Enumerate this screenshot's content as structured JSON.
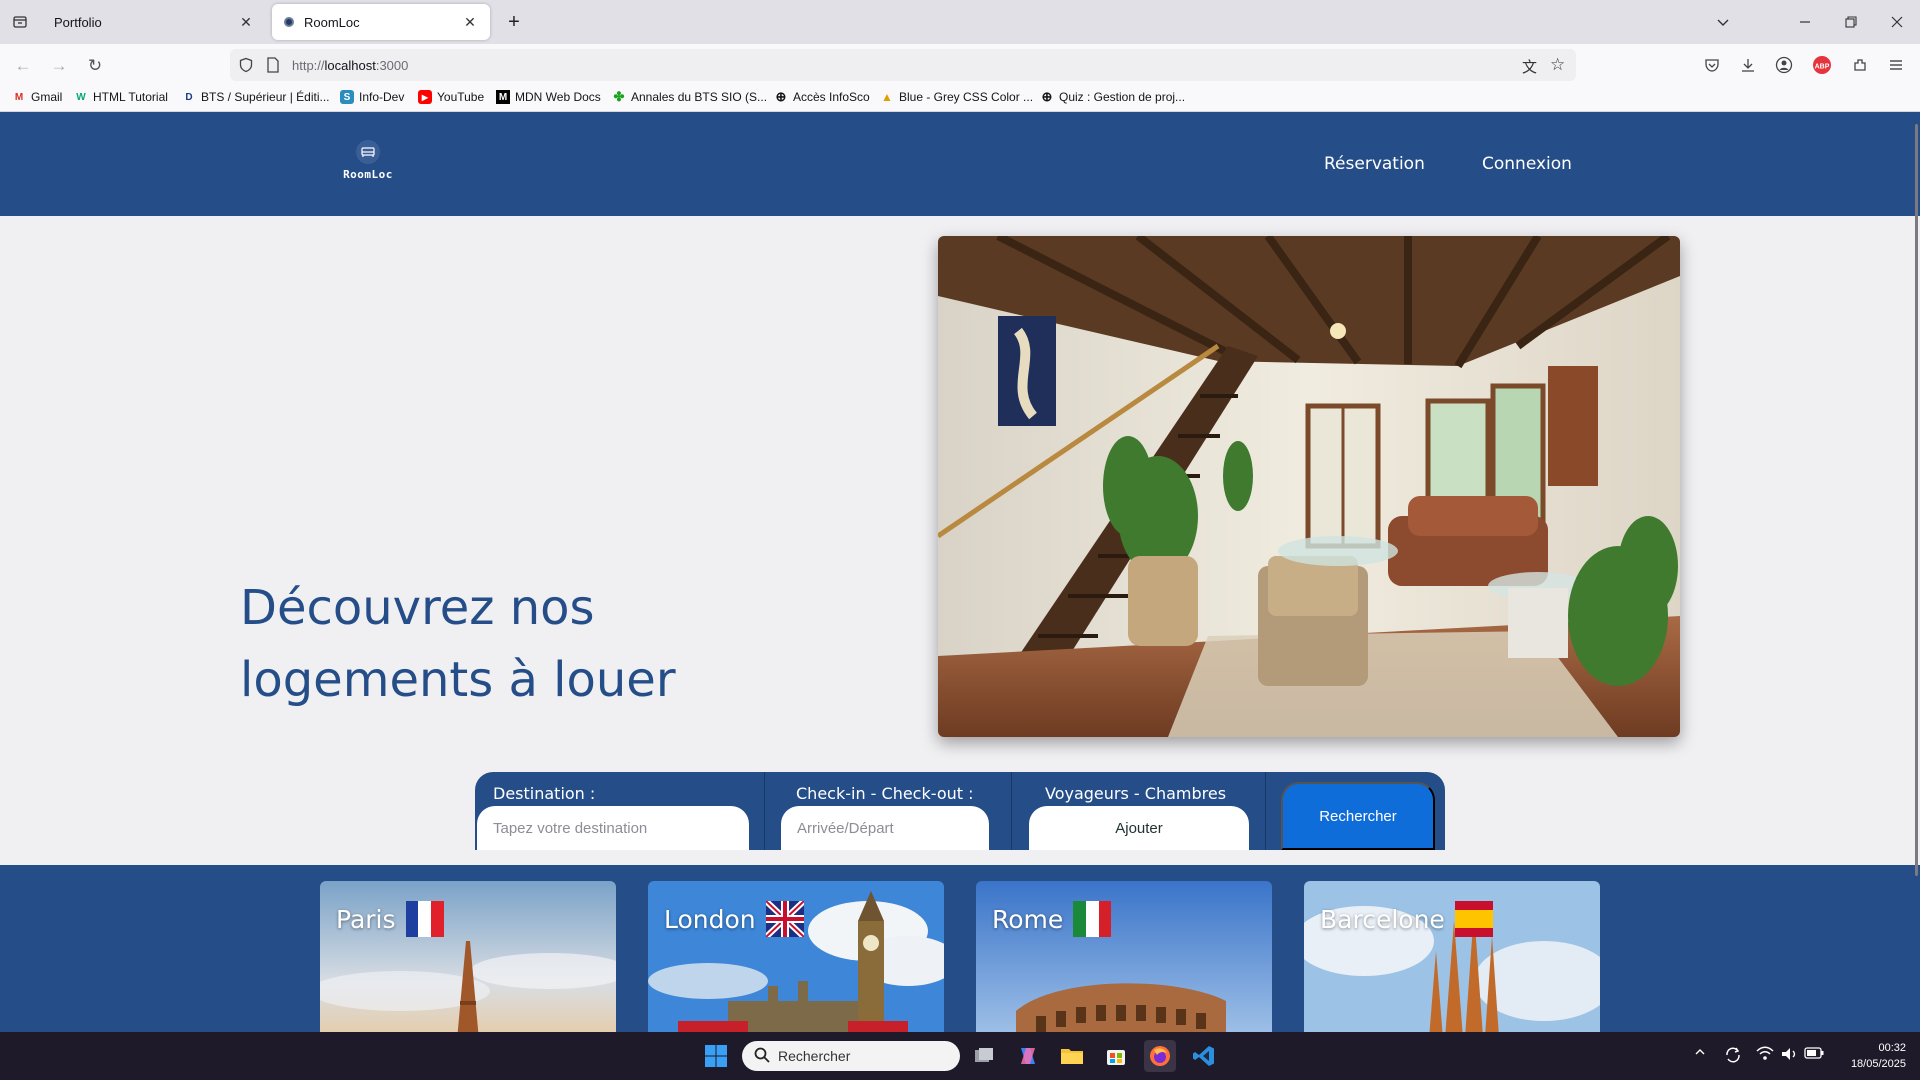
{
  "browser": {
    "tabs": [
      {
        "title": "Portfolio",
        "active": false
      },
      {
        "title": "RoomLoc",
        "active": true
      }
    ],
    "url_prefix": "http://",
    "url_host": "localhost",
    "url_rest": ":3000",
    "bookmarks": [
      {
        "label": "Gmail",
        "icon": "gmail-icon"
      },
      {
        "label": "HTML Tutorial",
        "icon": "w3schools-icon"
      },
      {
        "label": "BTS / Supérieur | Éditi...",
        "icon": "d-logo-icon"
      },
      {
        "label": "Info-Dev",
        "icon": "infodev-icon"
      },
      {
        "label": "YouTube",
        "icon": "youtube-icon"
      },
      {
        "label": "MDN Web Docs",
        "icon": "mdn-icon"
      },
      {
        "label": "Annales du BTS SIO (S...",
        "icon": "clover-icon"
      },
      {
        "label": "Accès InfoSco",
        "icon": "globe-icon"
      },
      {
        "label": "Blue - Grey CSS Color ...",
        "icon": "palette-icon"
      },
      {
        "label": "Quiz : Gestion de proj...",
        "icon": "globe-icon"
      }
    ]
  },
  "site": {
    "logo_text": "RoomLoc",
    "menu": [
      "Réservation",
      "Connexion"
    ],
    "hero_title_line1": "Découvrez nos",
    "hero_title_line2": "logements à louer",
    "search": {
      "destination_label": "Destination :",
      "destination_placeholder": "Tapez votre destination",
      "dates_label": "Check-in - Check-out :",
      "dates_placeholder": "Arrivée/Départ",
      "guests_label": "Voyageurs - Chambres",
      "guests_button": "Ajouter",
      "submit": "Rechercher"
    },
    "destinations": [
      {
        "city": "Paris",
        "flag": "fr"
      },
      {
        "city": "London",
        "flag": "gb"
      },
      {
        "city": "Rome",
        "flag": "it"
      },
      {
        "city": "Barcelone",
        "flag": "es"
      }
    ]
  },
  "taskbar": {
    "search_placeholder": "Rechercher",
    "time": "00:32",
    "date": "18/05/2025"
  },
  "colors": {
    "brand": "#254e89",
    "accent": "#0f6dd9"
  }
}
